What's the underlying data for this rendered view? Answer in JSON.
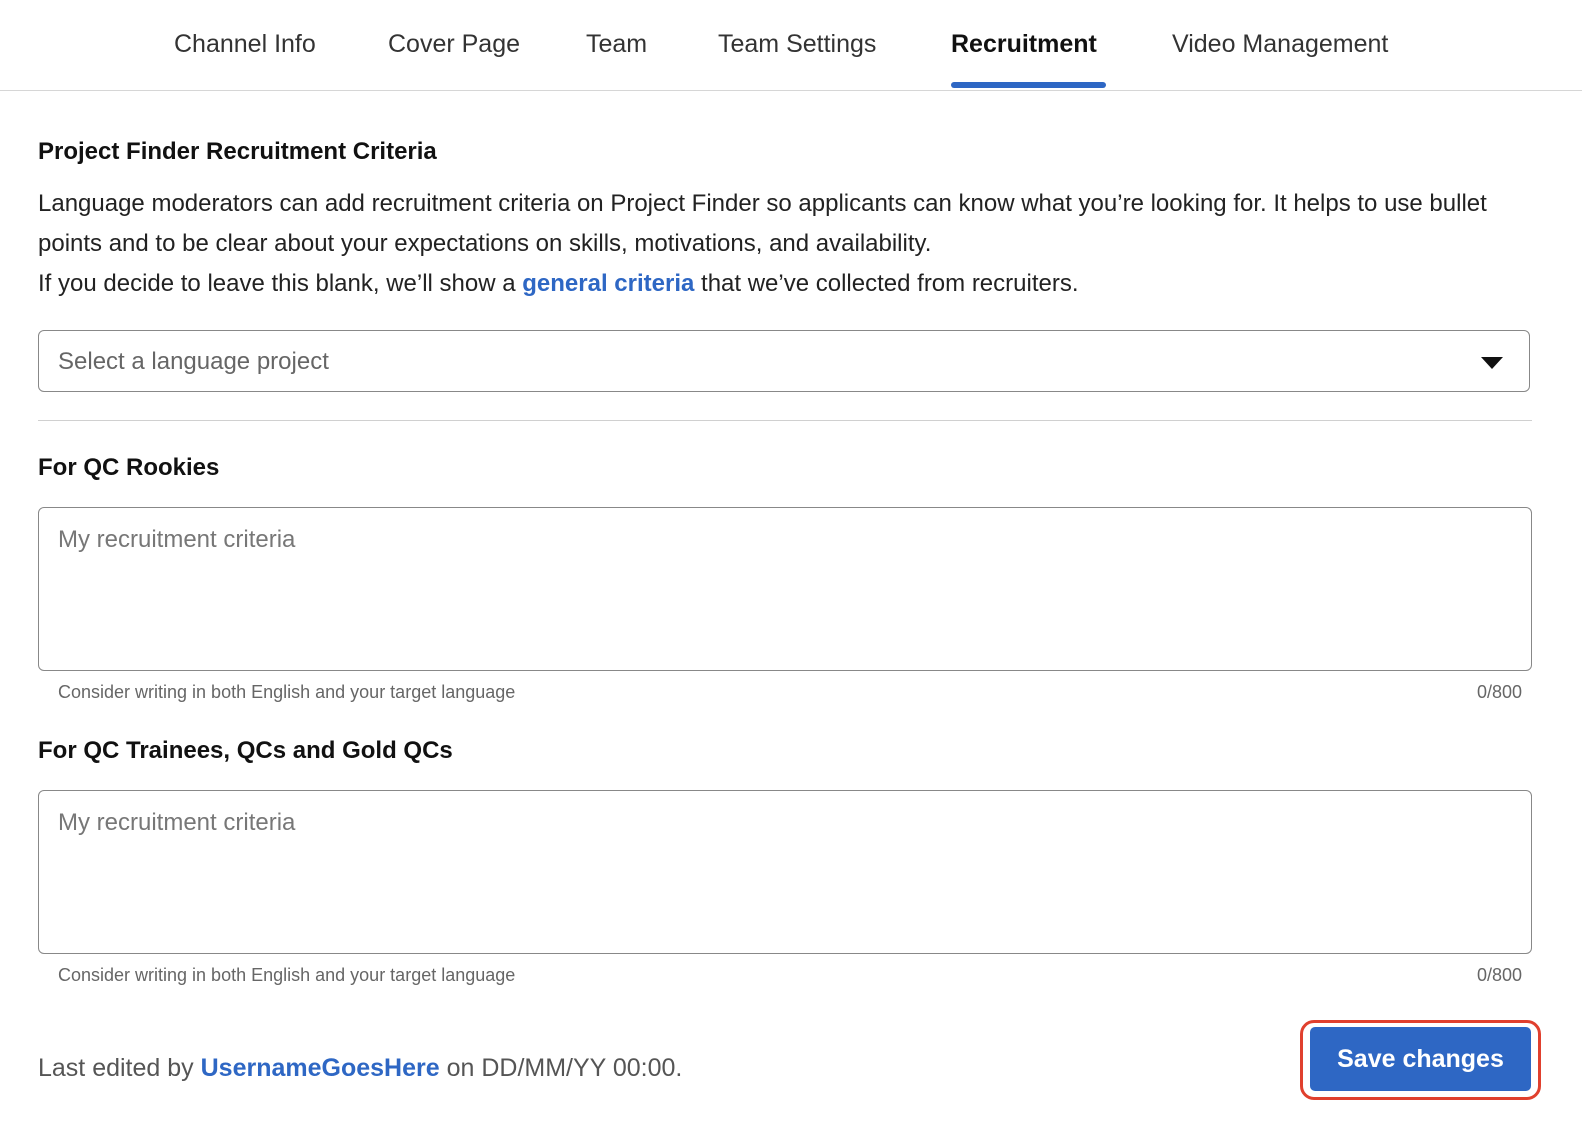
{
  "tabs": [
    {
      "label": "Channel Info"
    },
    {
      "label": "Cover Page"
    },
    {
      "label": "Team"
    },
    {
      "label": "Team Settings"
    },
    {
      "label": "Recruitment",
      "active": true
    },
    {
      "label": "Video Management"
    }
  ],
  "section": {
    "title": "Project Finder Recruitment Criteria",
    "desc_line1": "Language moderators can add recruitment criteria on Project Finder so applicants can know what you’re looking for. It helps to use bullet points and to be clear about your expectations on skills, motivations, and availability.",
    "desc_line2_prefix": "If you decide to leave this blank, we’ll show a ",
    "desc_line2_link": "general criteria",
    "desc_line2_suffix": " that we’ve collected from recruiters."
  },
  "language_select": {
    "placeholder": "Select a language project",
    "icon": "caret-down-icon"
  },
  "rookies": {
    "title": "For QC Rookies",
    "placeholder": "My recruitment criteria",
    "value": "",
    "hint": "Consider writing in both English and your target language",
    "count": "0/800"
  },
  "trainees": {
    "title": "For QC Trainees, QCs and Gold QCs",
    "placeholder": "My recruitment criteria",
    "value": "",
    "hint": "Consider writing in both English and your target language",
    "count": "0/800"
  },
  "footer": {
    "prefix": "Last edited by ",
    "username": "UsernameGoesHere",
    "suffix": " on DD/MM/YY 00:00.",
    "save_label": "Save changes"
  },
  "colors": {
    "accent": "#2e67c4",
    "highlight_outline": "#e0402e"
  }
}
